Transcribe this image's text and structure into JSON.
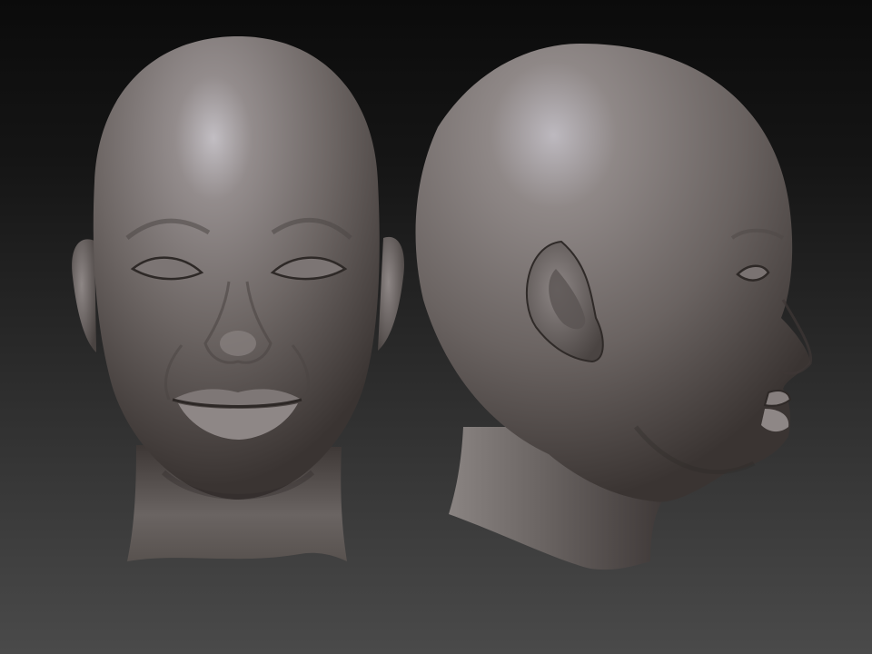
{
  "scene": {
    "background_top": "#0b0b0b",
    "background_bottom": "#4a4a4a",
    "clay_color": "#6e6866",
    "clay_highlight": "#bdb8bc",
    "clay_shadow": "#2c2827"
  },
  "models": [
    {
      "view": "front"
    },
    {
      "view": "side"
    }
  ]
}
